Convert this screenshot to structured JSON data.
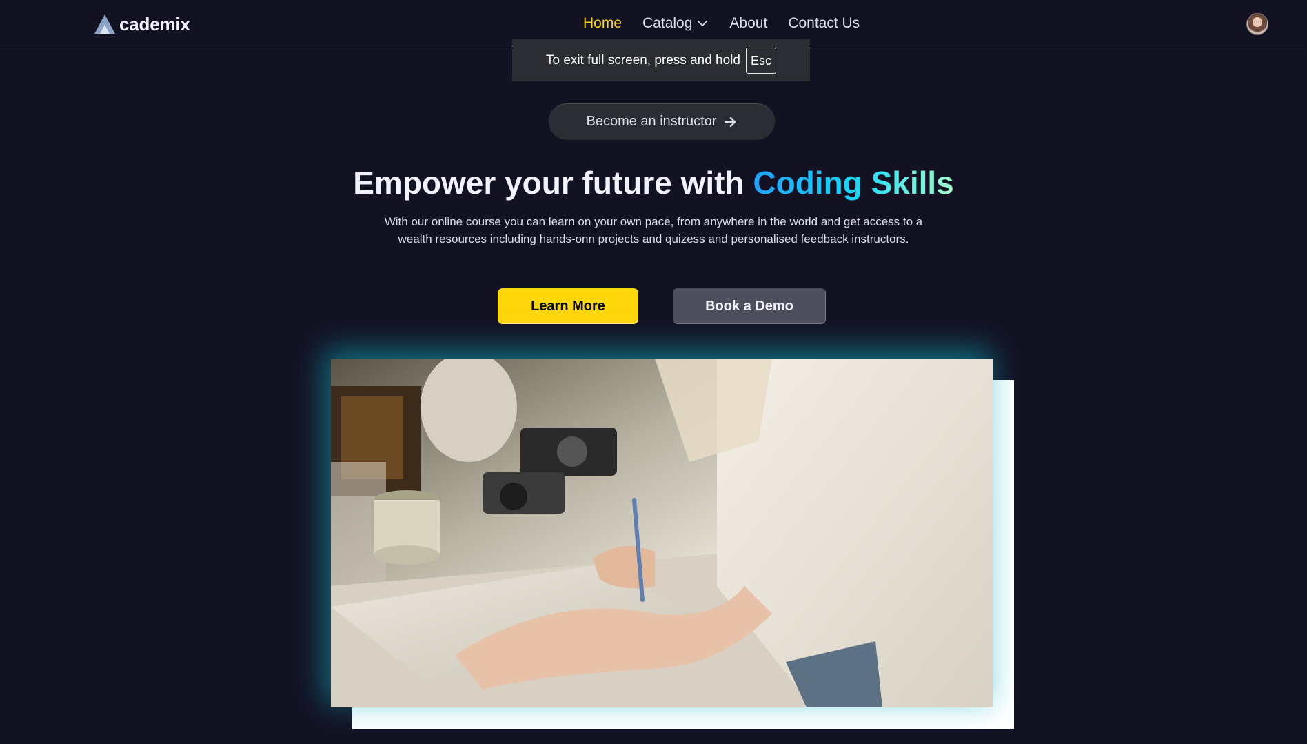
{
  "navbar": {
    "logo_text": "cademix",
    "links": [
      {
        "label": "Home",
        "active": true
      },
      {
        "label": "Catalog",
        "has_dropdown": true
      },
      {
        "label": "About"
      },
      {
        "label": "Contact Us"
      }
    ]
  },
  "fullscreen_toast": {
    "message": "To exit full screen, press and hold",
    "key": "Esc"
  },
  "hero": {
    "instructor_button": "Become an instructor",
    "title_prefix": "Empower your future with ",
    "title_highlight": "Coding Skills",
    "description": "With our online course you can learn on your own pace, from anywhere in the world and get access to a wealth resources including hands-onn projects and quizess and personalised feedback instructors.",
    "learn_more": "Learn More",
    "book_demo": "Book a Demo"
  },
  "colors": {
    "background": "#131223",
    "accent_yellow": "#ffd60a",
    "highlight_gradient": [
      "#1fa2ff",
      "#12d8fa",
      "#a6ffcb"
    ],
    "secondary_button": "#4e4f5c"
  },
  "icons": [
    "logo-icon",
    "chevron-down-icon",
    "arrow-right-icon",
    "avatar"
  ]
}
